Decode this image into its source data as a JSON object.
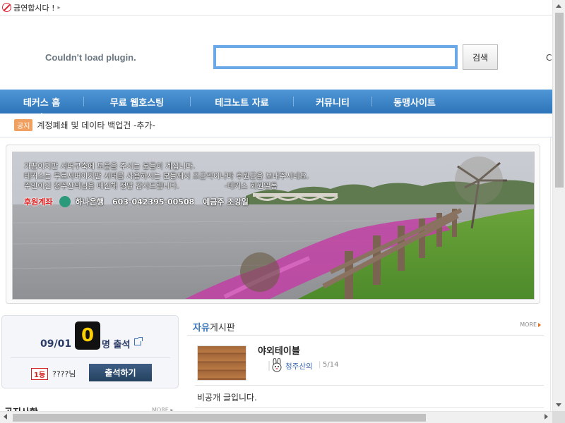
{
  "topbar": {
    "text": "금연합시다 !",
    "arrow": "▸"
  },
  "header": {
    "plugin_message": "Couldn't load plugin.",
    "search_value": "",
    "search_button": "검색",
    "cutoff_text": "C"
  },
  "nav": {
    "items": [
      {
        "label": "테커스 홈",
        "active": true
      },
      {
        "label": "무료 웹호스팅"
      },
      {
        "label": "테크노트 자료"
      },
      {
        "label": "커뮤니티"
      },
      {
        "label": "동맹사이트"
      }
    ]
  },
  "notice": {
    "badge": "공지",
    "text": "계정폐쇄 및 데이타 백업건 -추가-"
  },
  "banner": {
    "line1": "가끔이지만 서버구축에 도움을 주시는 분들이 계십니다.",
    "line2": "테커스는 무료서버이지만 서버를 사용하시는 분들께서 조금씩이나마 후원금을 보내주시네요.",
    "line3": "주인이신 청주산의님을 대신해 정말 감사드립니다.",
    "line3_sign": "-테커스 회원일동",
    "sponsor_label": "후원계좌",
    "bank": "하나은행",
    "account": "603-042395-00508",
    "holder": "예금주 조강일"
  },
  "attendance": {
    "date": "09/01",
    "count": "0",
    "unit": "명 출석",
    "rank_badge": "1등",
    "rank_user": "????님",
    "button": "출석하기"
  },
  "sidebar": {
    "section2_title": "공지사항",
    "section2_more": "MORE ▸"
  },
  "board": {
    "title_highlight": "자유",
    "title_rest": "게시판",
    "more": "MORE",
    "posts": [
      {
        "title": "야외테이블",
        "author": "청주산의",
        "date": "5/14"
      },
      {
        "title": "비공개 글입니다."
      }
    ]
  },
  "colors": {
    "nav_bg": "#3a83c6",
    "search_border": "#6aa8e8",
    "attendance_button": "#2f4d70",
    "count_digit": "#ffd000"
  }
}
